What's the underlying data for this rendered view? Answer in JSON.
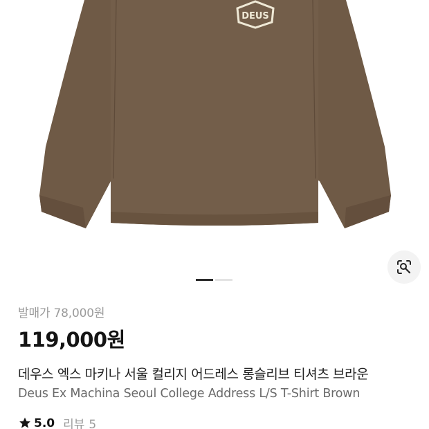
{
  "product": {
    "image": {
      "alt_icon": "brown-long-sleeve-tshirt-with-deus-logo",
      "logo_text": "DEUS",
      "shirt_color": "#6f5a46",
      "logo_color": "#efe9d6"
    },
    "gallery": {
      "count": 2,
      "active_index": 0,
      "lens_icon": "visual-search-icon"
    },
    "retail_price_label": "발매가",
    "retail_price": "78,000원",
    "price": "119,000원",
    "name_ko": "데우스 엑스 마키나 서울 컬리지 어드레스 롱슬리브 티셔츠 브라운",
    "name_en": "Deus Ex Machina Seoul College Address L/S T-Shirt Brown",
    "rating": {
      "star_icon": "star-icon",
      "score": "5.0",
      "reviews_label": "리뷰",
      "reviews_count": "5"
    }
  },
  "colors": {
    "price_text": "#141414",
    "muted_text": "#9b9b9b",
    "indicator_active": "#2a2a2a",
    "indicator_inactive": "#e3e3e3"
  }
}
